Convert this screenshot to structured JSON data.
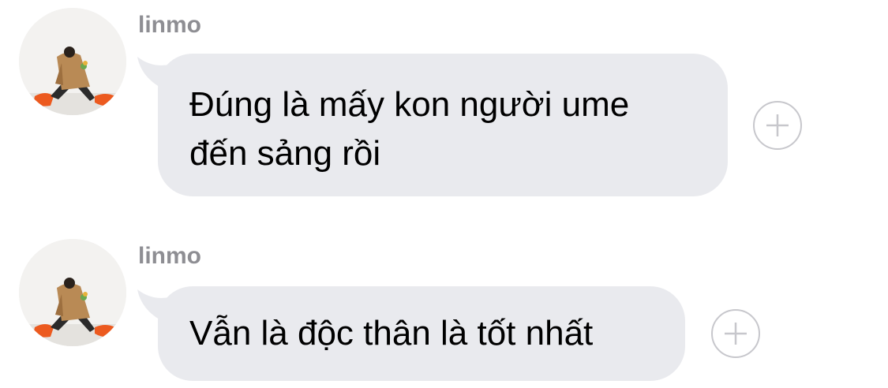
{
  "messages": [
    {
      "sender": "linmo",
      "text": "Đúng là mấy kon người ume đến sảng rồi",
      "avatar_icon": "user-avatar-photo",
      "reaction_icon": "add-reaction-plus-icon"
    },
    {
      "sender": "linmo",
      "text": "Vẫn là độc thân là tốt nhất",
      "avatar_icon": "user-avatar-photo",
      "reaction_icon": "add-reaction-plus-icon"
    }
  ],
  "colors": {
    "bubble": "#e9eaee",
    "sender_name": "#8e8e93",
    "reaction_border": "#c7c7cc",
    "text": "#000000"
  }
}
